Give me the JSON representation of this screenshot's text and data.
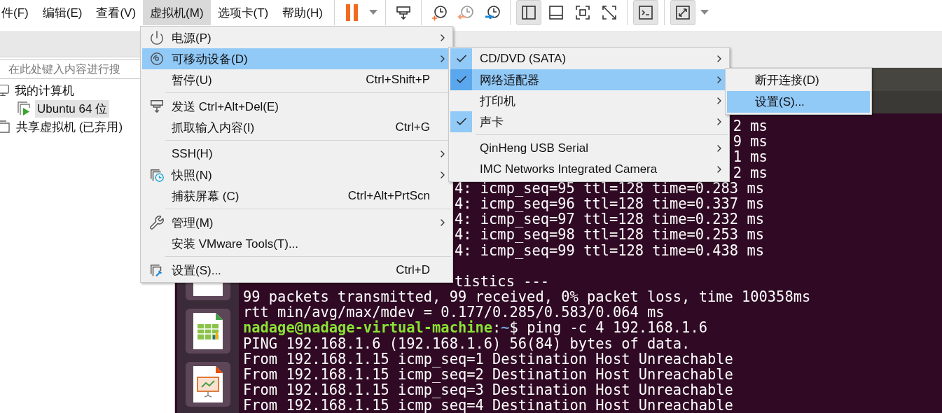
{
  "menubar": {
    "items": [
      {
        "label": "件(F)",
        "selected": false
      },
      {
        "label": "编辑(E)",
        "selected": false
      },
      {
        "label": "查看(V)",
        "selected": false
      },
      {
        "label": "虚拟机(M)",
        "selected": true
      },
      {
        "label": "选项卡(T)",
        "selected": false
      },
      {
        "label": "帮助(H)",
        "selected": false
      }
    ]
  },
  "toolbar": {
    "groups": [
      [
        {
          "kind": "pause",
          "pressed": false
        },
        {
          "kind": "caret",
          "pressed": false
        }
      ],
      [
        {
          "kind": "send-keys",
          "pressed": false
        }
      ],
      [
        {
          "kind": "snapshot-take",
          "pressed": false
        },
        {
          "kind": "snapshot-revert",
          "pressed": false
        },
        {
          "kind": "snapshot-manage",
          "pressed": false
        }
      ],
      [
        {
          "kind": "view-sidebar",
          "pressed": true
        },
        {
          "kind": "view-bottom",
          "pressed": false
        },
        {
          "kind": "view-fit",
          "pressed": false
        },
        {
          "kind": "view-off",
          "pressed": false
        }
      ],
      [
        {
          "kind": "console",
          "pressed": true
        }
      ],
      [
        {
          "kind": "fullscreen",
          "pressed": true
        },
        {
          "kind": "caret",
          "pressed": false
        }
      ]
    ]
  },
  "sidebar": {
    "search": {
      "placeholder": "在此处键入内容进行搜"
    },
    "tree": [
      {
        "label": "我的计算机",
        "selected": false,
        "children": [
          {
            "label": "Ubuntu 64 位",
            "selected": true
          }
        ]
      },
      {
        "label": "共享虚拟机 (已弃用)",
        "selected": false
      }
    ]
  },
  "terminal": {
    "blocks": [
      [
        {
          "kind": "output",
          "text": "2 ms"
        },
        {
          "kind": "output",
          "text": "9 ms"
        },
        {
          "kind": "output",
          "text": "1 ms"
        },
        {
          "kind": "output",
          "text": "2 ms"
        },
        {
          "kind": "output",
          "text": "4: icmp_seq=95 ttl=128 time=0.283 ms"
        },
        {
          "kind": "output",
          "text": "4: icmp_seq=96 ttl=128 time=0.337 ms"
        },
        {
          "kind": "output",
          "text": "4: icmp_seq=97 ttl=128 time=0.232 ms"
        },
        {
          "kind": "output",
          "text": "4: icmp_seq=98 ttl=128 time=0.253 ms"
        },
        {
          "kind": "output",
          "text": "4: icmp_seq=99 ttl=128 time=0.438 ms"
        }
      ],
      [
        {
          "kind": "output",
          "text": "tistics ---"
        },
        {
          "kind": "output",
          "text": "99 packets transmitted, 99 received, 0% packet loss, time 100358ms"
        },
        {
          "kind": "output",
          "text": "rtt min/avg/max/mdev = 0.177/0.285/0.583/0.064 ms"
        },
        {
          "kind": "prompt",
          "user": "nadage@nadage-virtual-machine",
          "colon": ":",
          "path": "~",
          "command": "$ ping -c 4 192.168.1.6"
        },
        {
          "kind": "output",
          "text": "PING 192.168.1.6 (192.168.1.6) 56(84) bytes of data."
        },
        {
          "kind": "output",
          "text": "From 192.168.1.15 icmp_seq=1 Destination Host Unreachable"
        },
        {
          "kind": "output",
          "text": "From 192.168.1.15 icmp_seq=2 Destination Host Unreachable"
        },
        {
          "kind": "output",
          "text": "From 192.168.1.15 icmp_seq=3 Destination Host Unreachable"
        },
        {
          "kind": "output",
          "text": "From 192.168.1.15 icmp_seq=4 Destination Host Unreachable"
        }
      ]
    ]
  },
  "vm_menu": {
    "groups": [
      [
        {
          "label": "电源(P)",
          "submenu": true,
          "selected": false
        },
        {
          "label": "可移动设备(D)",
          "submenu": true,
          "selected": true
        },
        {
          "label": "暂停(U)",
          "shortcut": "Ctrl+Shift+P",
          "submenu": false,
          "selected": false
        }
      ],
      [
        {
          "label": "发送 Ctrl+Alt+Del(E)",
          "submenu": false,
          "selected": false
        },
        {
          "label": "抓取输入内容(I)",
          "shortcut": "Ctrl+G",
          "submenu": false,
          "selected": false
        }
      ],
      [
        {
          "label": "SSH(H)",
          "submenu": true,
          "selected": false
        },
        {
          "label": "快照(N)",
          "submenu": true,
          "selected": false
        },
        {
          "label": "捕获屏幕 (C)",
          "shortcut": "Ctrl+Alt+PrtScn",
          "submenu": false,
          "selected": false
        }
      ],
      [
        {
          "label": "管理(M)",
          "submenu": true,
          "selected": false
        },
        {
          "label": "安装 VMware Tools(T)...",
          "submenu": false,
          "selected": false
        }
      ],
      [
        {
          "label": "设置(S)...",
          "shortcut": "Ctrl+D",
          "submenu": false,
          "selected": false
        }
      ]
    ]
  },
  "devices_menu": {
    "groups": [
      [
        {
          "label": "CD/DVD (SATA)",
          "checked": true,
          "submenu": true,
          "selected": false
        },
        {
          "label": "网络适配器",
          "checked": true,
          "submenu": true,
          "selected": true
        },
        {
          "label": "打印机",
          "checked": false,
          "submenu": true,
          "selected": false
        },
        {
          "label": "声卡",
          "checked": true,
          "submenu": true,
          "selected": false
        }
      ],
      [
        {
          "label": "QinHeng USB Serial",
          "checked": false,
          "submenu": true,
          "selected": false
        },
        {
          "label": "IMC Networks Integrated Camera",
          "checked": false,
          "submenu": true,
          "selected": false
        }
      ]
    ]
  },
  "adapter_menu": {
    "items": [
      {
        "label": "断开连接(D)",
        "selected": false
      },
      {
        "label": "设置(S)...",
        "selected": true
      }
    ]
  }
}
